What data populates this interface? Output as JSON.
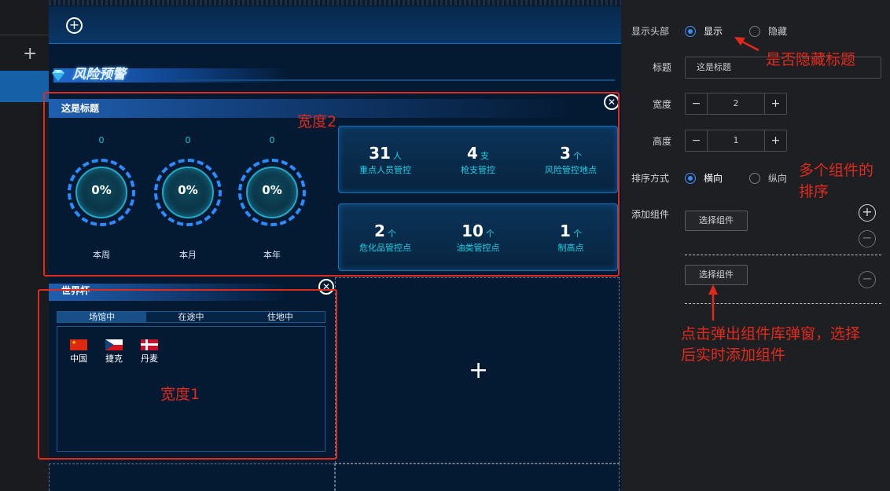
{
  "canvas": {
    "section_title": "风险预警",
    "add_icon": "plus-circle-icon",
    "add_component_plus": "+"
  },
  "widget2": {
    "title": "这是标题",
    "gauges": [
      {
        "value": "0",
        "percent": "0%",
        "label": "本周"
      },
      {
        "value": "0",
        "percent": "0%",
        "label": "本月"
      },
      {
        "value": "0",
        "percent": "0%",
        "label": "本年"
      }
    ],
    "stats_top": [
      {
        "value": "31",
        "unit": "人",
        "label": "重点人员管控"
      },
      {
        "value": "4",
        "unit": "支",
        "label": "枪支管控"
      },
      {
        "value": "3",
        "unit": "个",
        "label": "风险管控地点"
      }
    ],
    "stats_bottom": [
      {
        "value": "2",
        "unit": "个",
        "label": "危化品管控点"
      },
      {
        "value": "10",
        "unit": "个",
        "label": "油类管控点"
      },
      {
        "value": "1",
        "unit": "个",
        "label": "制高点"
      }
    ]
  },
  "widget1": {
    "title": "世界杯",
    "tabs": [
      "场馆中",
      "在途中",
      "住地中"
    ],
    "countries": [
      "中国",
      "捷克",
      "丹麦"
    ]
  },
  "settings": {
    "show_header_label": "显示头部",
    "show_option": "显示",
    "hide_option": "隐藏",
    "title_label": "标题",
    "title_value": "这是标题",
    "width_label": "宽度",
    "width_value": "2",
    "height_label": "高度",
    "height_value": "1",
    "sort_label": "排序方式",
    "sort_horizontal": "横向",
    "sort_vertical": "纵向",
    "add_component_label": "添加组件",
    "select_component_btn": "选择组件",
    "select_component_btn2": "选择组件",
    "minus": "−",
    "plus": "+"
  },
  "annotations": {
    "hide_title_note": "是否隐藏标题",
    "width2_note": "宽度2",
    "width1_note": "宽度1",
    "sort_note_1": "多个组件的",
    "sort_note_2": "排序",
    "popup_note_1": "点击弹出组件库弹窗，选择",
    "popup_note_2": "后实时添加组件"
  },
  "colors": {
    "accent": "#3b8cf7",
    "annotation_red": "#e02a1c",
    "stat_cyan": "#19d2e6",
    "canvas_bg": "#041a33"
  }
}
